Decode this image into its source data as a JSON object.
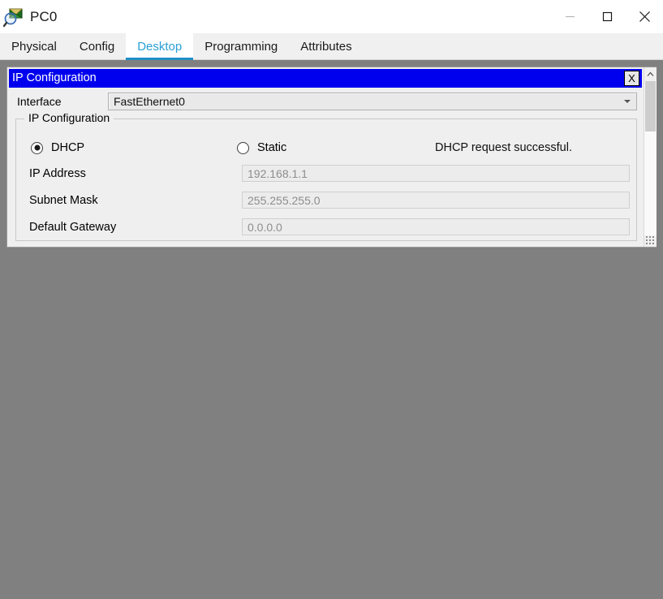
{
  "window": {
    "title": "PC0",
    "icon": "packet-tracer-pc-icon",
    "controls": {
      "minimize": "minimize-icon",
      "maximize": "maximize-icon",
      "close": "close-icon"
    }
  },
  "tabs": [
    {
      "label": "Physical",
      "active": false
    },
    {
      "label": "Config",
      "active": false
    },
    {
      "label": "Desktop",
      "active": true
    },
    {
      "label": "Programming",
      "active": false
    },
    {
      "label": "Attributes",
      "active": false
    }
  ],
  "panel": {
    "caption": "IP Configuration",
    "close_label": "X"
  },
  "interface": {
    "label": "Interface",
    "value": "FastEthernet0",
    "arrow": "chevron-down-icon"
  },
  "group": {
    "title": "IP Configuration",
    "radios": [
      {
        "label": "DHCP",
        "checked": true
      },
      {
        "label": "Static",
        "checked": false
      }
    ],
    "status": "DHCP request successful.",
    "fields": [
      {
        "label": "IP Address",
        "value": "192.168.1.1"
      },
      {
        "label": "Subnet Mask",
        "value": "255.255.255.0"
      },
      {
        "label": "Default Gateway",
        "value": "0.0.0.0"
      }
    ]
  },
  "scrollbar": {
    "up_arrow": "scroll-up-icon",
    "grip": "resize-grip-icon"
  },
  "colors": {
    "accent_tab": "#2a9fd6",
    "tab_underline": "#1f8fc6",
    "panel_caption_bg": "#0000ee",
    "window_bg": "#808080",
    "dialog_bg": "#efefef"
  }
}
